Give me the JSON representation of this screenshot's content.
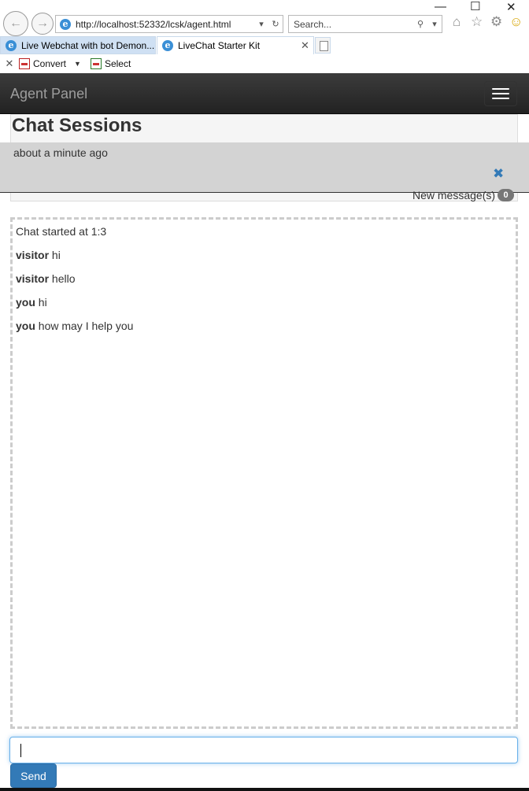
{
  "browser": {
    "address": "http://localhost:52332/lcsk/agent.html",
    "search_placeholder": "Search...",
    "tabs": [
      {
        "label": "Live Webchat with bot Demon..."
      },
      {
        "label": "LiveChat Starter Kit"
      }
    ],
    "command_bar": {
      "convert_label": "Convert",
      "select_label": "Select"
    }
  },
  "navbar": {
    "brand": "Agent Panel"
  },
  "sessions": {
    "title": "Chat Sessions",
    "items": [
      {
        "time": "about a minute ago"
      }
    ],
    "new_messages_label": "New message(s)",
    "new_messages_count": "0"
  },
  "chat": {
    "started": "Chat started at 1:3",
    "messages": [
      {
        "sender": "visitor",
        "text": "hi"
      },
      {
        "sender": "visitor",
        "text": "hello"
      },
      {
        "sender": "you",
        "text": "hi"
      },
      {
        "sender": "you",
        "text": "how may I help you"
      }
    ],
    "input_value": "",
    "send_label": "Send"
  },
  "colors": {
    "navbar": "#222222",
    "accent": "#337ab7",
    "session_row": "#d3d3d3"
  }
}
